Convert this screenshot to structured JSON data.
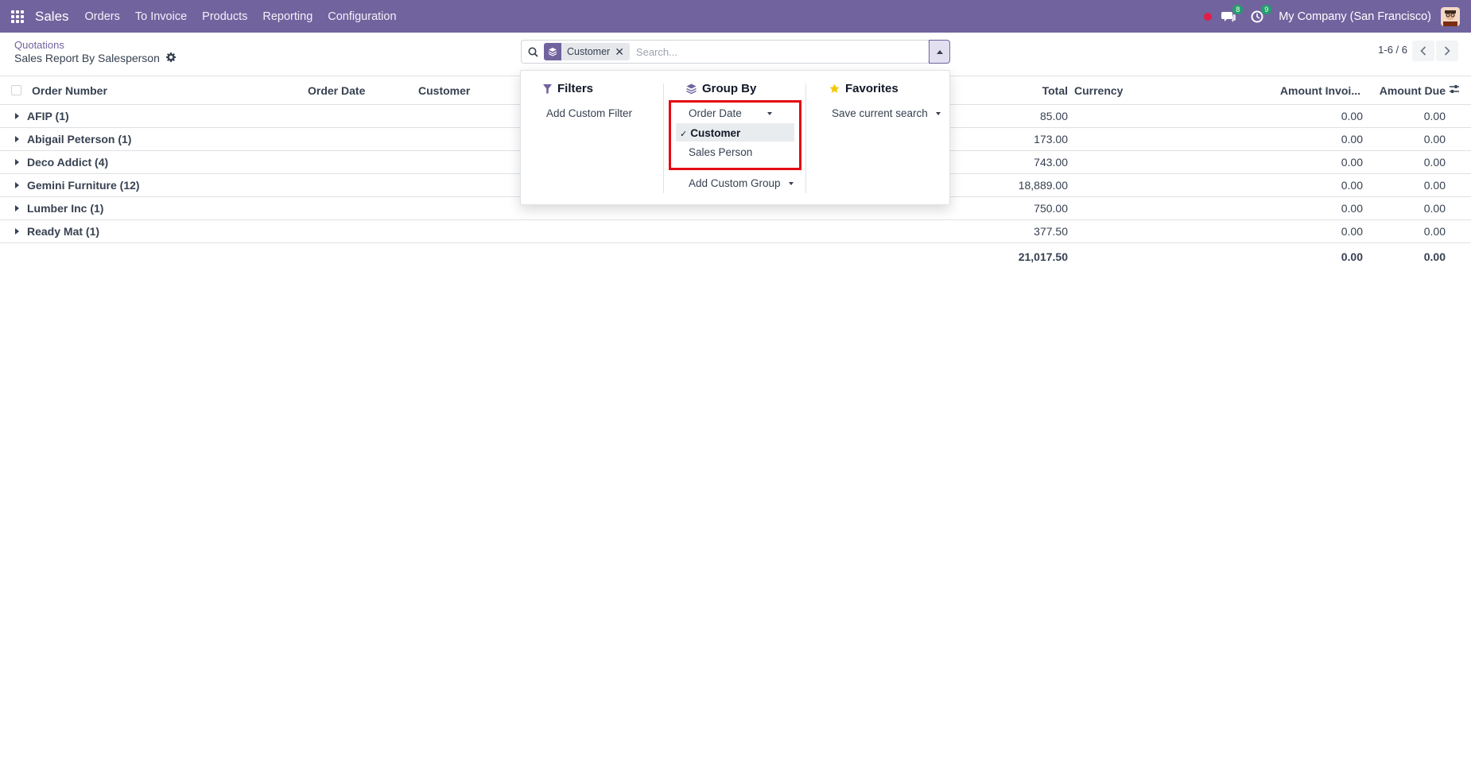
{
  "navbar": {
    "brand": "Sales",
    "menu": [
      "Orders",
      "To Invoice",
      "Products",
      "Reporting",
      "Configuration"
    ],
    "messages_count": "8",
    "activities_count": "9",
    "company": "My Company (San Francisco)"
  },
  "control_panel": {
    "breadcrumb": "Quotations",
    "title": "Sales Report By Salesperson",
    "search": {
      "facet_label": "Customer",
      "facet_close": "✕",
      "placeholder": "Search..."
    },
    "pager": "1-6 / 6"
  },
  "table": {
    "headers": {
      "order_number": "Order Number",
      "order_date": "Order Date",
      "customer": "Customer",
      "total": "Total",
      "currency": "Currency",
      "amount_invoiced": "Amount Invoi...",
      "amount_due": "Amount Due"
    },
    "rows": [
      {
        "name": "AFIP (1)",
        "total": "85.00",
        "invoiced": "0.00",
        "due": "0.00"
      },
      {
        "name": "Abigail Peterson (1)",
        "total": "173.00",
        "invoiced": "0.00",
        "due": "0.00"
      },
      {
        "name": "Deco Addict (4)",
        "total": "743.00",
        "invoiced": "0.00",
        "due": "0.00"
      },
      {
        "name": "Gemini Furniture (12)",
        "total": "18,889.00",
        "invoiced": "0.00",
        "due": "0.00"
      },
      {
        "name": "Lumber Inc (1)",
        "total": "750.00",
        "invoiced": "0.00",
        "due": "0.00"
      },
      {
        "name": "Ready Mat (1)",
        "total": "377.50",
        "invoiced": "0.00",
        "due": "0.00"
      }
    ],
    "footer": {
      "total": "21,017.50",
      "invoiced": "0.00",
      "due": "0.00"
    }
  },
  "dropdown": {
    "filters": {
      "title": "Filters",
      "add_custom": "Add Custom Filter"
    },
    "group_by": {
      "title": "Group By",
      "items": [
        "Order Date",
        "Customer",
        "Sales Person"
      ],
      "selected": "Customer",
      "check": "✓",
      "add_custom": "Add Custom Group"
    },
    "favorites": {
      "title": "Favorites",
      "save_search": "Save current search"
    }
  },
  "colors": {
    "brand": "#71639e",
    "highlight": "#e50914",
    "badge": "#22a06b"
  }
}
